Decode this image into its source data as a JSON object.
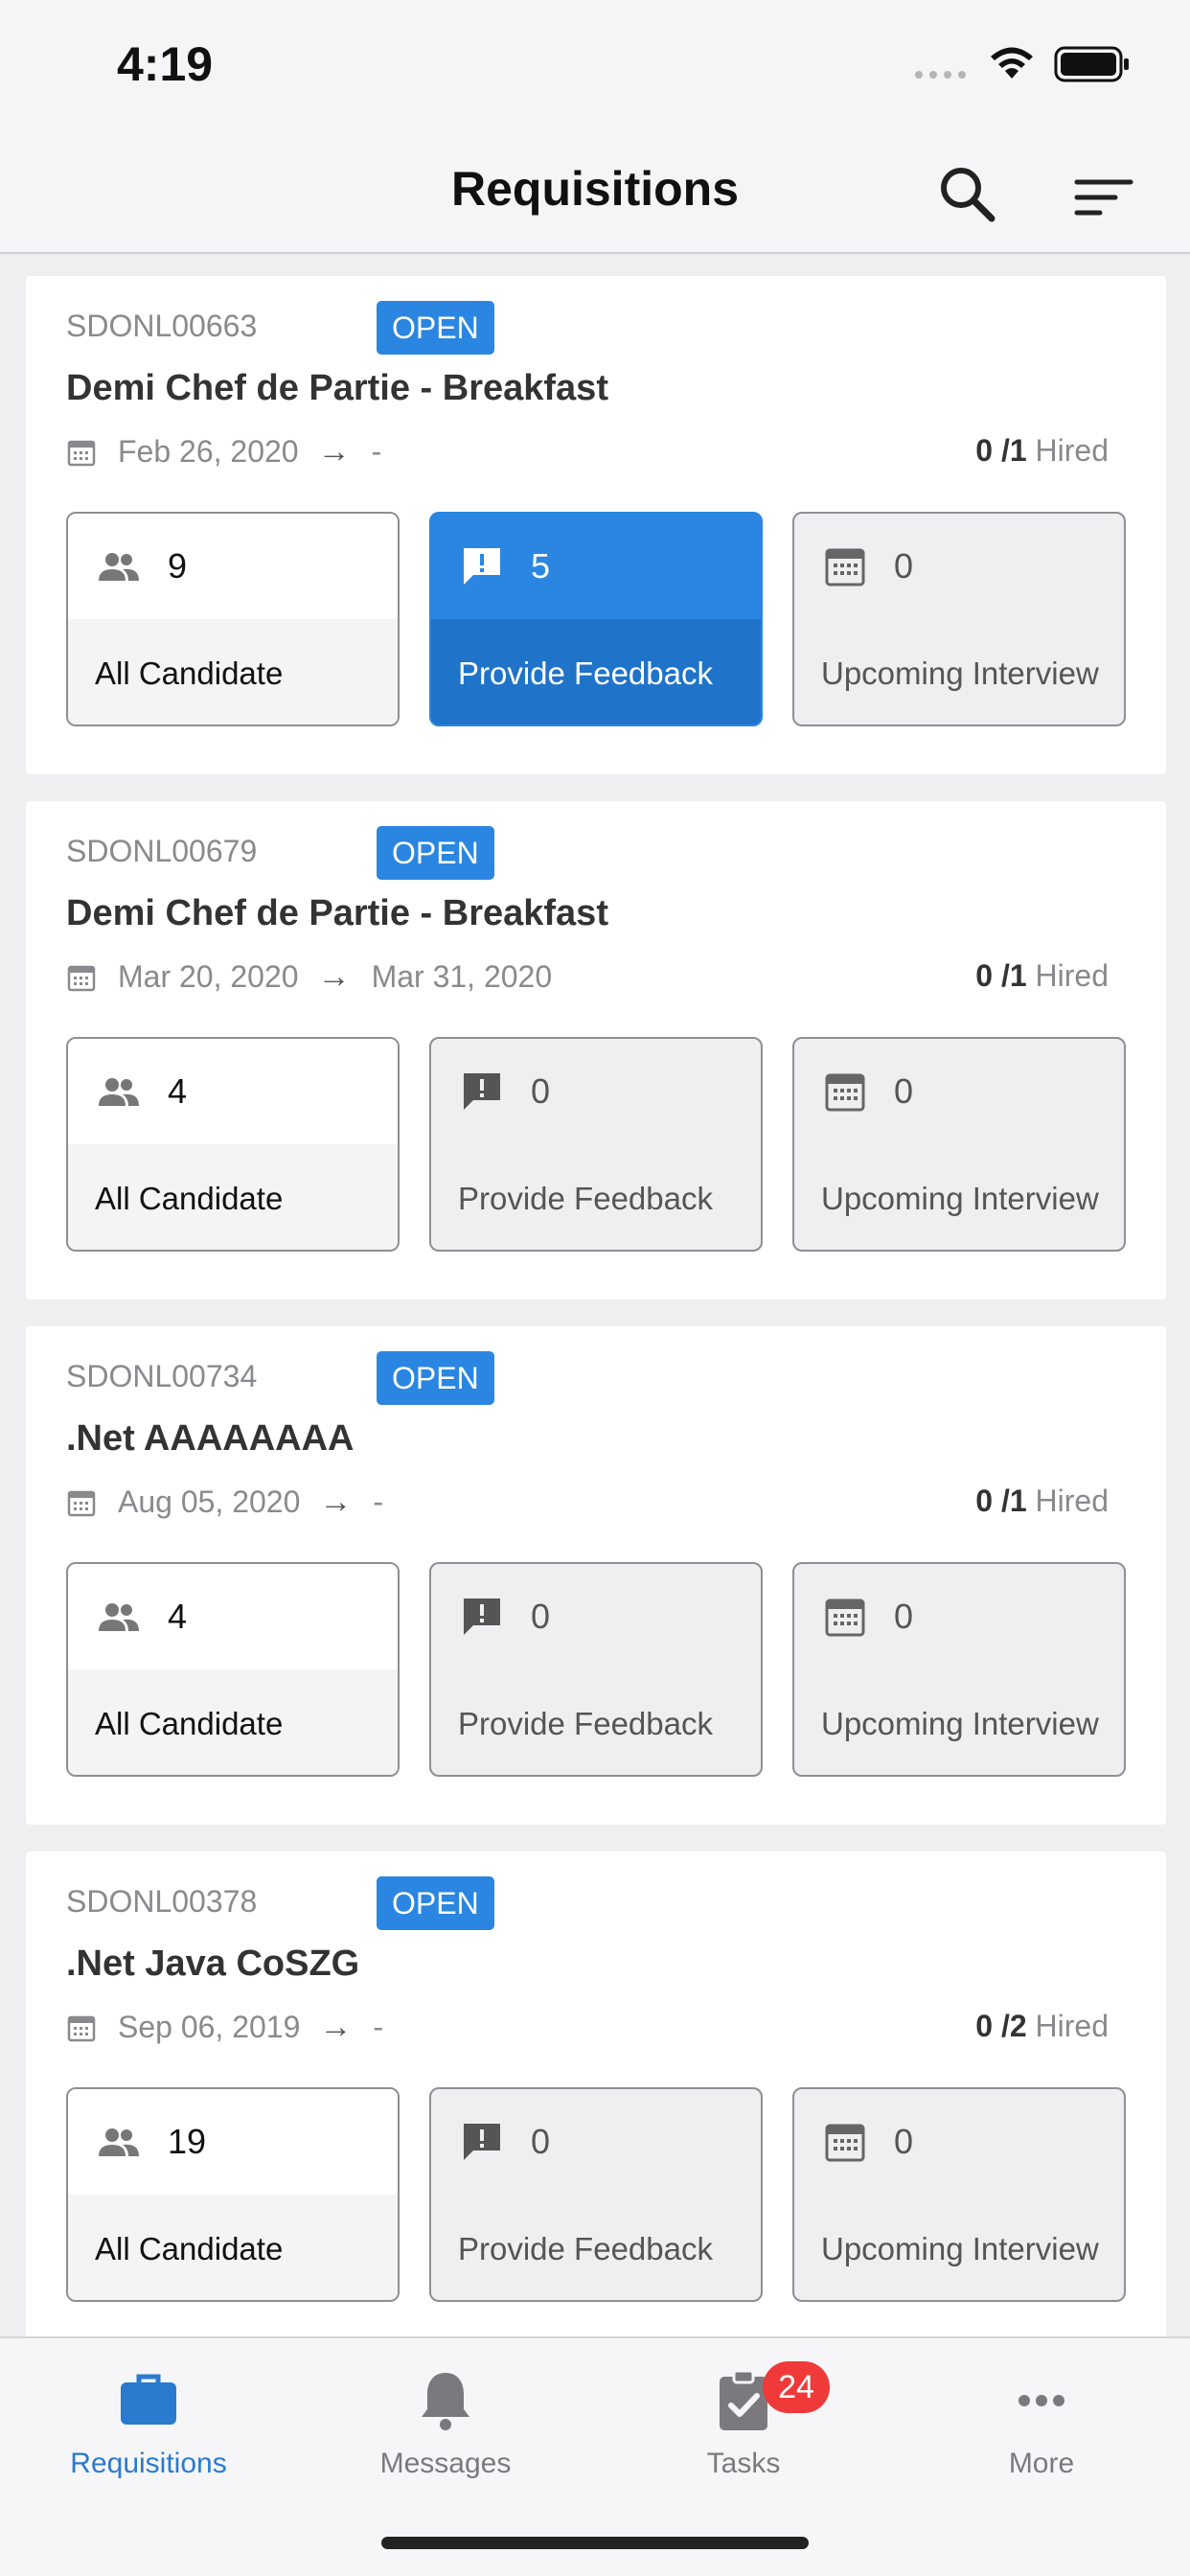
{
  "status_bar": {
    "time": "4:19"
  },
  "header": {
    "title": "Requisitions"
  },
  "requisitions": [
    {
      "id": "SDONL00663",
      "status": "OPEN",
      "title": "Demi Chef de Partie - Breakfast",
      "start_date": "Feb 26, 2020",
      "end_date": "-",
      "hired_count": "0",
      "hired_total": "/1",
      "hired_label": "Hired",
      "all_candidate_count": "9",
      "all_candidate_label": "All Candidate",
      "feedback_count": "5",
      "feedback_label": "Provide Feedback",
      "interview_count": "0",
      "interview_label": "Upcoming Interview",
      "feedback_active": true
    },
    {
      "id": "SDONL00679",
      "status": "OPEN",
      "title": "Demi Chef de Partie - Breakfast",
      "start_date": "Mar 20, 2020",
      "end_date": "Mar 31, 2020",
      "hired_count": "0",
      "hired_total": "/1",
      "hired_label": "Hired",
      "all_candidate_count": "4",
      "all_candidate_label": "All Candidate",
      "feedback_count": "0",
      "feedback_label": "Provide Feedback",
      "interview_count": "0",
      "interview_label": "Upcoming Interview",
      "feedback_active": false
    },
    {
      "id": "SDONL00734",
      "status": "OPEN",
      "title": ".Net AAAAAAAA",
      "start_date": "Aug 05, 2020",
      "end_date": "-",
      "hired_count": "0",
      "hired_total": "/1",
      "hired_label": "Hired",
      "all_candidate_count": "4",
      "all_candidate_label": "All Candidate",
      "feedback_count": "0",
      "feedback_label": "Provide Feedback",
      "interview_count": "0",
      "interview_label": "Upcoming Interview",
      "feedback_active": false
    },
    {
      "id": "SDONL00378",
      "status": "OPEN",
      "title": ".Net Java CoSZG",
      "start_date": "Sep 06, 2019",
      "end_date": "-",
      "hired_count": "0",
      "hired_total": "/2",
      "hired_label": "Hired",
      "all_candidate_count": "19",
      "all_candidate_label": "All Candidate",
      "feedback_count": "0",
      "feedback_label": "Provide Feedback",
      "interview_count": "0",
      "interview_label": "Upcoming Interview",
      "feedback_active": false
    }
  ],
  "tab_bar": {
    "items": [
      {
        "label": "Requisitions",
        "icon": "briefcase-icon",
        "active": true
      },
      {
        "label": "Messages",
        "icon": "bell-icon",
        "active": false
      },
      {
        "label": "Tasks",
        "icon": "clipboard-check-icon",
        "active": false,
        "badge": "24"
      },
      {
        "label": "More",
        "icon": "more-icon",
        "active": false
      }
    ]
  },
  "colors": {
    "accent": "#2a86e0",
    "accent_dark": "#1f73c8",
    "badge_red": "#f03a3a",
    "tab_active": "#2a7bd0"
  }
}
